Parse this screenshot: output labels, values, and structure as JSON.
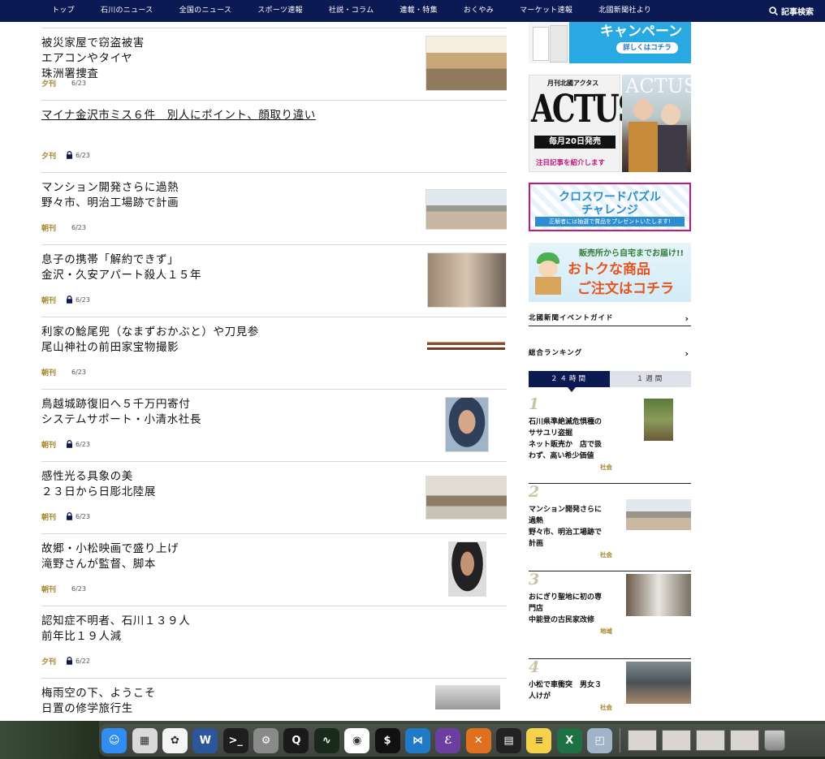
{
  "nav": {
    "items": [
      "トップ",
      "石川のニュース",
      "全国のニュース",
      "スポーツ速報",
      "社説・コラム",
      "連載・特集",
      "おくやみ",
      "マーケット速報",
      "北國新聞社より"
    ],
    "search_label": "記事検索"
  },
  "articles": [
    {
      "lines": [
        "被災家屋で窃盗被害",
        "エアコンやタイヤ",
        "珠洲署捜査"
      ],
      "edition": "夕刊",
      "date": "6/23",
      "locked": false
    },
    {
      "lines": [
        "マイナ金沢市ミス６件　別人にポイント、顔取り違い"
      ],
      "edition": "夕刊",
      "date": "6/23",
      "locked": true
    },
    {
      "lines": [
        "マンション開発さらに過熱",
        "野々市、明治工場跡で計画"
      ],
      "edition": "朝刊",
      "date": "6/23",
      "locked": false
    },
    {
      "lines": [
        "息子の携帯「解約できず」",
        "金沢・久安アパート殺人１５年"
      ],
      "edition": "朝刊",
      "date": "6/23",
      "locked": true
    },
    {
      "lines": [
        "利家の鯰尾兜（なまずおかぶと）や刀見参",
        "尾山神社の前田家宝物撮影"
      ],
      "edition": "朝刊",
      "date": "6/23",
      "locked": false
    },
    {
      "lines": [
        "鳥越城跡復旧へ５千万円寄付",
        "システムサポート・小清水社長"
      ],
      "edition": "朝刊",
      "date": "6/23",
      "locked": true
    },
    {
      "lines": [
        "感性光る具象の美",
        "２３日から日彫北陸展"
      ],
      "edition": "朝刊",
      "date": "6/23",
      "locked": true
    },
    {
      "lines": [
        "故郷・小松映画で盛り上げ",
        "滝野さんが監督、脚本"
      ],
      "edition": "朝刊",
      "date": "6/23",
      "locked": false
    },
    {
      "lines": [
        "認知症不明者、石川１３９人",
        "前年比１９人減"
      ],
      "edition": "夕刊",
      "date": "6/22",
      "locked": true
    },
    {
      "lines": [
        "梅雨空の下、ようこそ",
        "日置の修学旅行生"
      ],
      "edition": "",
      "date": "",
      "locked": false
    }
  ],
  "sidebar": {
    "campaign_banner": {
      "headline": "キャンペーン",
      "cta": "詳しくはコチラ"
    },
    "actus_banner": {
      "top": "月刊北國アクタス",
      "logo": "ACTUS",
      "release": "毎月20日発売",
      "note": "注目記事を紹介します",
      "cover_logo": "ACTUS"
    },
    "crossword_banner": {
      "line1": "クロスワードパズル",
      "line2": "チャレンジ",
      "note": "正解者には抽選で賞品をプレゼントいたします!"
    },
    "delivery_banner": {
      "top": "販売所から自宅までお届け!!",
      "line1": "おトクな商品",
      "line2": "ご注文はコチラ"
    },
    "event_guide": "北國新聞イベントガイド",
    "ranking_title": "総合ランキング",
    "ranking_tabs": [
      "２４時間",
      "１週間"
    ],
    "ranking": [
      {
        "rank": "1",
        "lines": [
          "石川県準絶滅危惧種の",
          "ササユリ盗掘",
          "ネット販売か　店で扱",
          "わず、高い希少価値"
        ],
        "category": "社会"
      },
      {
        "rank": "2",
        "lines": [
          "マンション開発さらに",
          "過熱",
          "野々市、明治工場跡で",
          "計画"
        ],
        "category": "社会"
      },
      {
        "rank": "3",
        "lines": [
          "おにぎり聖地に初の専",
          "門店",
          "中能登の古民家改修"
        ],
        "category": "地域"
      },
      {
        "rank": "4",
        "lines": [
          "小松で車衝突　男女３",
          "人けが"
        ],
        "category": "社会"
      }
    ]
  },
  "dock": {
    "apps": [
      "finder-icon",
      "launchpad-icon",
      "photos-icon",
      "word-icon",
      "terminal-icon",
      "system-preferences-icon",
      "quicktime-icon",
      "activity-monitor-icon",
      "chrome-icon",
      "iterm-icon",
      "vscode-icon",
      "emacs-icon",
      "xquartz-icon",
      "kindle-icon",
      "notes-icon",
      "excel-icon",
      "preview-icon"
    ]
  },
  "colors": {
    "nav_bg": "#0b1a52",
    "edition": "#a4862c",
    "rank_num": "#c9c3a3"
  }
}
